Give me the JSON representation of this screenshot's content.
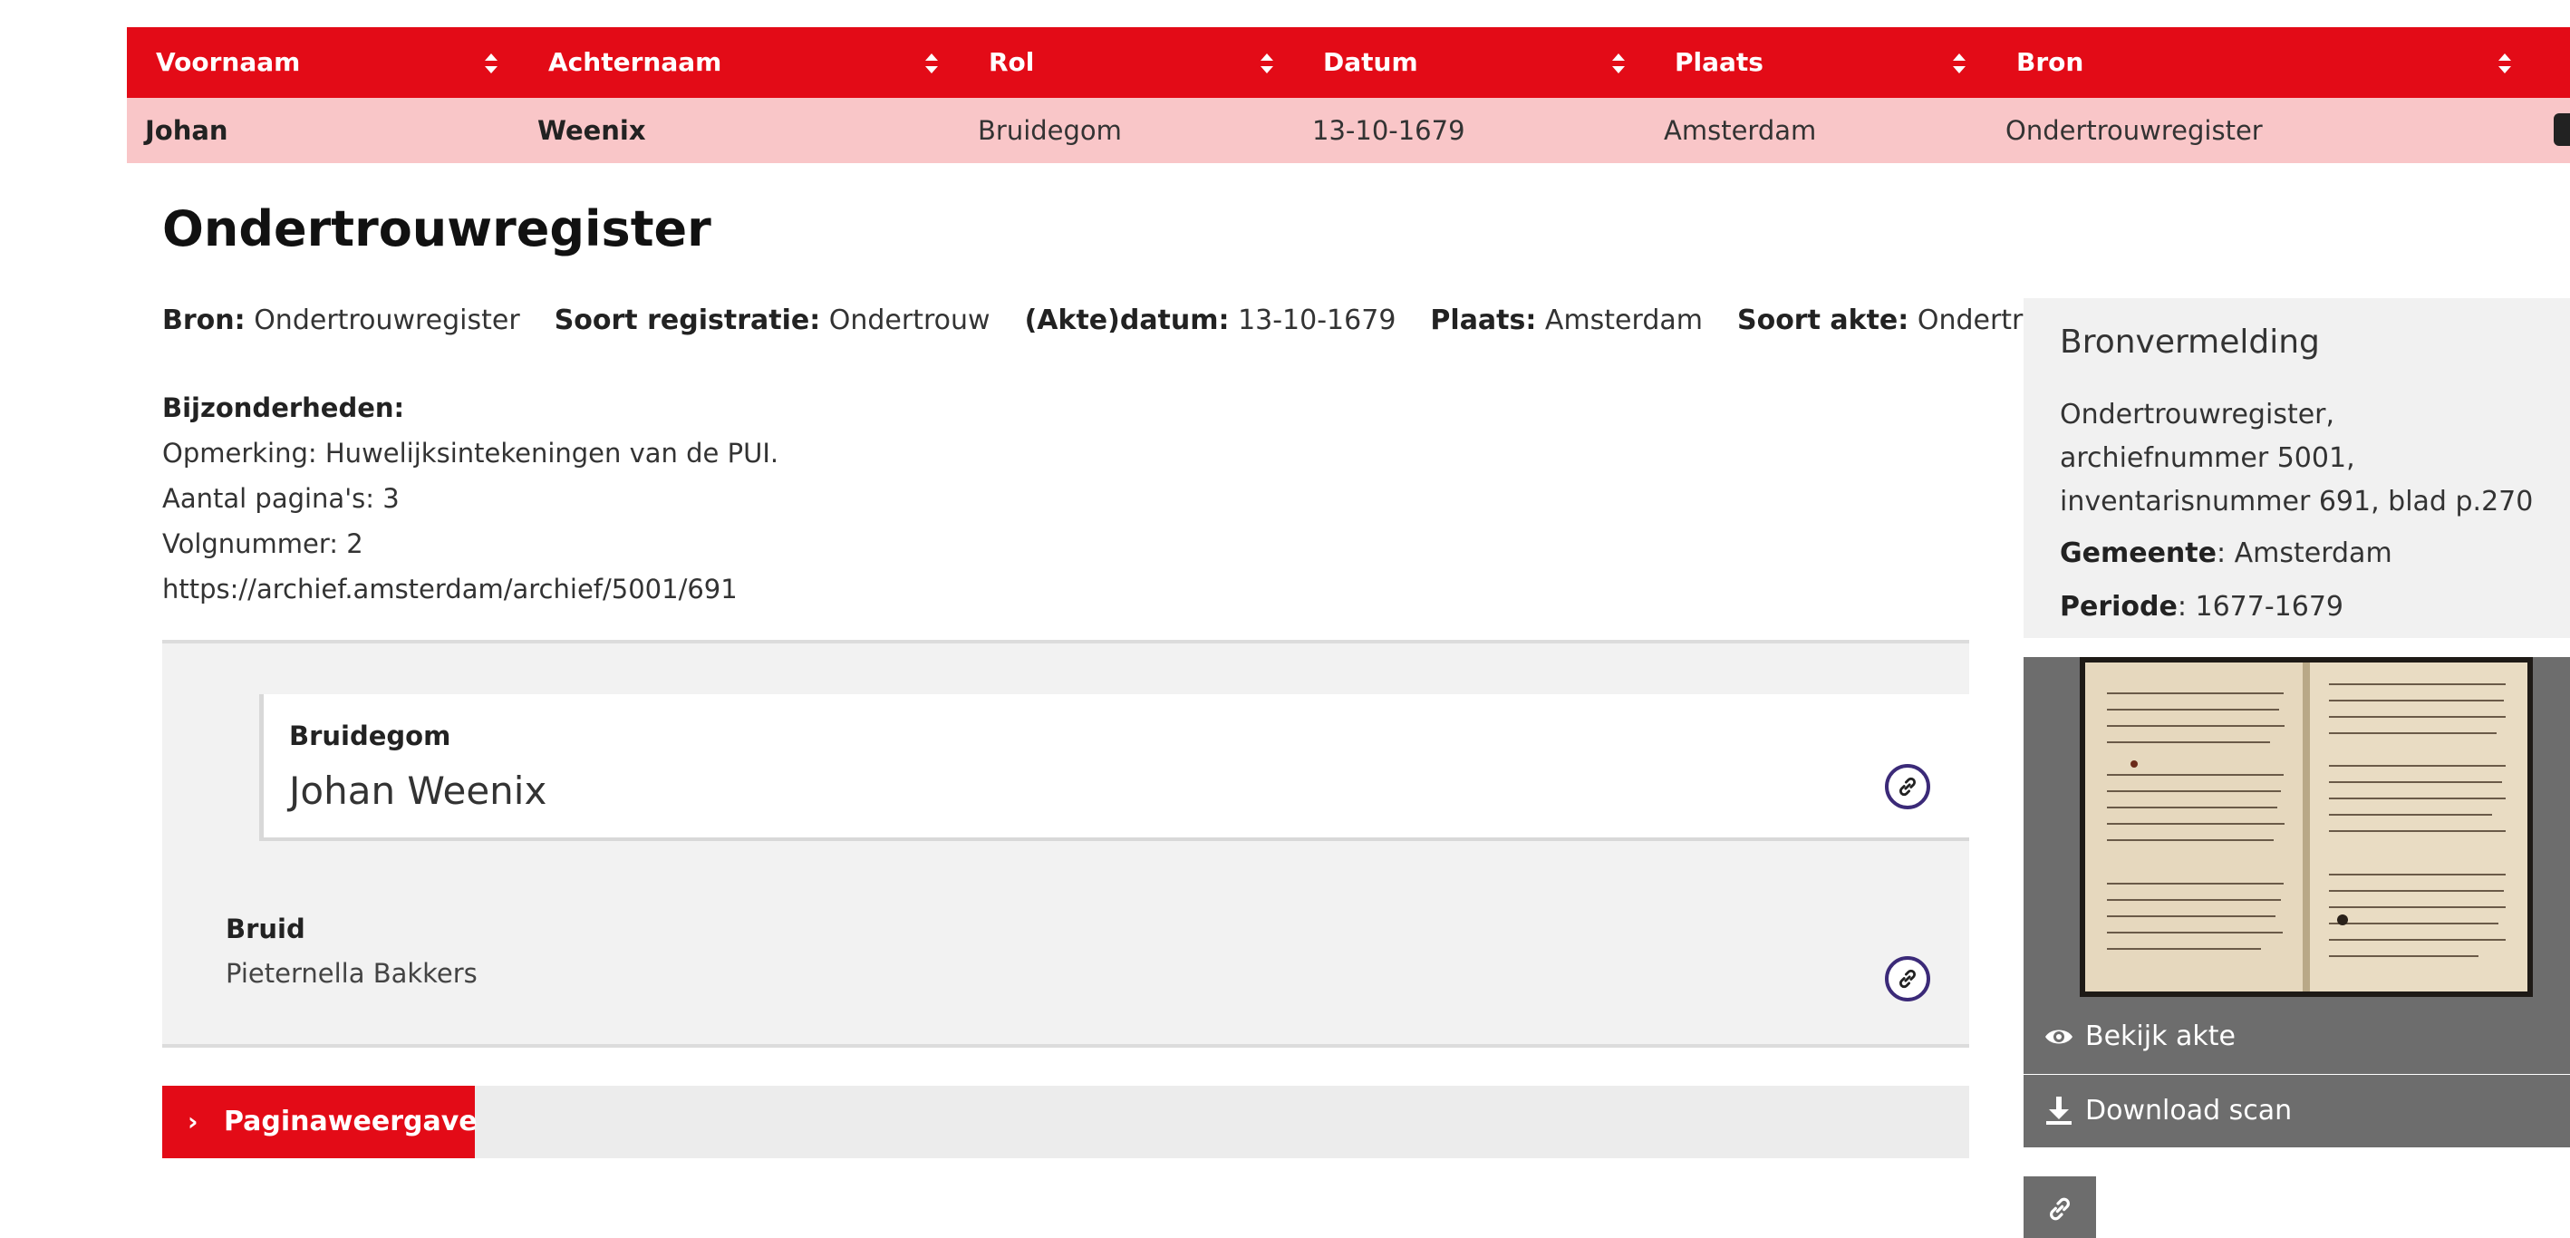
{
  "table": {
    "headers": [
      "Voornaam",
      "Achternaam",
      "Rol",
      "Datum",
      "Plaats",
      "Bron"
    ],
    "row": [
      "Johan",
      "Weenix",
      "Bruidegom",
      "13-10-1679",
      "Amsterdam",
      "Ondertrouwregister"
    ]
  },
  "record": {
    "title": "Ondertrouwregister",
    "meta": [
      {
        "label": "Bron:",
        "value": "Ondertrouwregister"
      },
      {
        "label": "Soort registratie:",
        "value": "Ondertrouw"
      },
      {
        "label": "(Akte)datum:",
        "value": "13-10-1679"
      },
      {
        "label": "Plaats:",
        "value": "Amsterdam"
      },
      {
        "label": "Soort akte:",
        "value": "Ondertrouw"
      }
    ],
    "details_title": "Bijzonderheden:",
    "details": [
      "Opmerking: Huwelijksintekeningen van de PUI.",
      "Aantal pagina's: 3",
      "Volgnummer: 2",
      "https://archief.amsterdam/archief/5001/691"
    ]
  },
  "persons": [
    {
      "role": "Bruidegom",
      "name": "Johan Weenix"
    },
    {
      "role": "Bruid",
      "name": "Pieternella Bakkers"
    }
  ],
  "paginaweergave": {
    "label": "Paginaweergave",
    "icon": "chevron-right-icon"
  },
  "bronvermelding": {
    "title": "Bronvermelding",
    "text": "Ondertrouwregister, archiefnummer 5001, inventarisnummer 691, blad p.270",
    "gemeente_label": "Gemeente",
    "gemeente_value": ": Amsterdam",
    "periode_label": "Periode",
    "periode_value": ": 1677-1679"
  },
  "scan": {
    "view_label": "Bekijk akte",
    "view_icon": "eye-icon",
    "download_label": "Download scan",
    "download_icon": "download-icon",
    "link_icon": "link-icon"
  },
  "colors": {
    "accent": "#e30b17",
    "row_highlight": "#f9c6c8",
    "link_ring": "#3b2a78",
    "sidebar_dark": "#6d6d6d"
  }
}
